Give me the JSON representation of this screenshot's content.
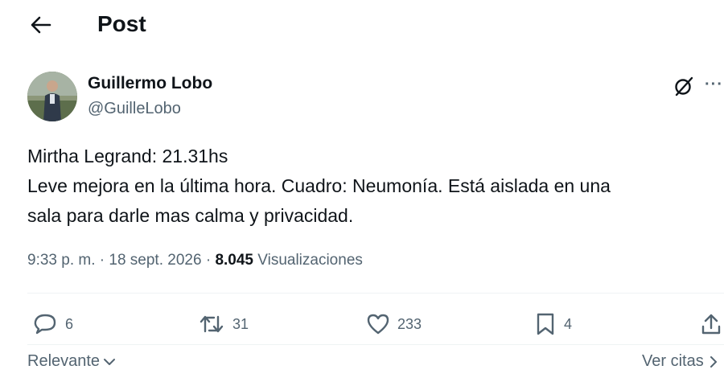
{
  "header": {
    "title": "Post",
    "back_icon": "arrow-left-icon"
  },
  "author": {
    "name": "Guillermo Lobo",
    "handle": "@GuilleLobo"
  },
  "tweet": {
    "lines": [
      "Mirtha Legrand: 21.31hs",
      "Leve mejora en la última hora. Cuadro: Neumonía. Está aislada en una",
      "sala para darle mas calma y privacidad."
    ]
  },
  "meta": {
    "time": "9:33 p. m.",
    "separator": "·",
    "date": "18 sept. 2026",
    "views_count": "8.045",
    "views_label": "Visualizaciones"
  },
  "actions": {
    "replies": "6",
    "reposts": "31",
    "likes": "233",
    "bookmarks": "4"
  },
  "footer": {
    "sort_label": "Relevante",
    "quotes_label": "Ver citas"
  },
  "colors": {
    "text": "#0f1419",
    "secondary": "#536471",
    "divider": "#eff3f4"
  }
}
